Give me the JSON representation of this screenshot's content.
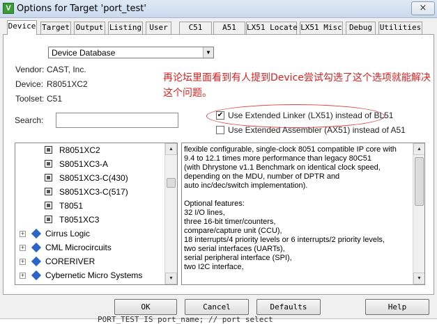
{
  "window": {
    "title": "Options for Target 'port_test'",
    "app_icon": "V",
    "close_glyph": "×"
  },
  "tabs": [
    "Device",
    "Target",
    "Output",
    "Listing",
    "User",
    "C51",
    "A51",
    "LX51 Locate",
    "LX51 Misc",
    "Debug",
    "Utilities"
  ],
  "device": {
    "database_select": "Device Database",
    "vendor_label": "Vendor:",
    "vendor_value": "CAST, Inc.",
    "device_label": "Device:",
    "device_value": "R8051XC2",
    "toolset_label": "Toolset:",
    "toolset_value": "C51",
    "search_label": "Search:",
    "search_value": ""
  },
  "annotation": {
    "text": "再论坛里面看到有人提到Device尝试勾选了这个选项就能解决这个问题。",
    "color": "#d92020"
  },
  "options": {
    "use_lx51": {
      "label": "Use Extended Linker (LX51) instead of BL51",
      "checked": true,
      "mark": "✔"
    },
    "use_ax51": {
      "label": "Use Extended Assembler (AX51) instead of A51",
      "checked": false,
      "mark": ""
    }
  },
  "tree": {
    "devices": [
      "R8051XC2",
      "S8051XC3-A",
      "S8051XC3-C(430)",
      "S8051XC3-C(517)",
      "T8051",
      "T8051XC3"
    ],
    "vendors": [
      "Cirrus Logic",
      "CML Microcircuits",
      "CORERIVER",
      "Cybernetic Micro Systems"
    ],
    "expander_glyph": "+"
  },
  "description": {
    "text": "flexible configurable, single-clock 8051 compatible IP core with\n9.4 to 12.1 times more performance than legacy 80C51\n(with Dhrystone v1.1 Benchmark on identical clock speed,\ndepending on the MDU, number of  DPTR and\nauto inc/dec/switch implementation).\n\nOptional features:\n32 I/O lines,\nthree 16-bit timer/counters,\ncompare/capture unit (CCU),\n18 interrupts/4 priority levels or 6 interrupts/2 priority levels,\ntwo serial interfaces (UARTs),\nserial peripheral interface (SPI),\ntwo I2C interface,"
  },
  "buttons": {
    "ok": "OK",
    "cancel": "Cancel",
    "defaults": "Defaults",
    "help": "Help"
  },
  "bottom_strip": {
    "text": "PORT_TEST  IS  port_name;  //  port  select"
  }
}
